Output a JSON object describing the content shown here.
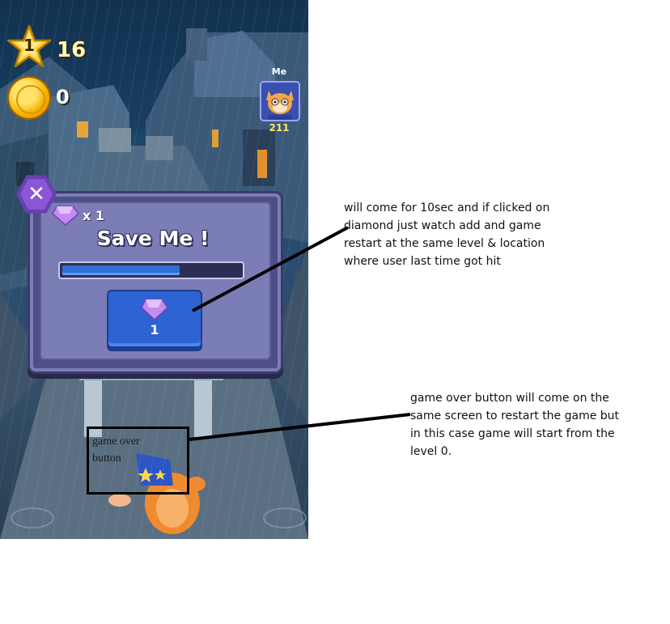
{
  "hud": {
    "level": "1",
    "score": "16",
    "coins": "0"
  },
  "player": {
    "label": "Me",
    "score": "211"
  },
  "save_dialog": {
    "gem_multiplier": "x 1",
    "title": "Save Me !",
    "timer_progress": 0.66,
    "button_cost": "1"
  },
  "annotation_box_label": "game over\nbutton",
  "notes": {
    "diamond": "will come for 10sec and if clicked on\ndiamond just watch add and game\nrestart at the same level & location\nwhere user last time got hit",
    "game_over": "game over button will come on the\nsame screen to restart the game but\nin this case game will start from the\nlevel 0."
  },
  "colors": {
    "dialog": "#7b7db7",
    "button": "#2d63d3",
    "gem": "#b77be8"
  },
  "icons": [
    "star-icon",
    "coin-icon",
    "close-icon",
    "gem-icon",
    "cat-avatar-icon"
  ]
}
